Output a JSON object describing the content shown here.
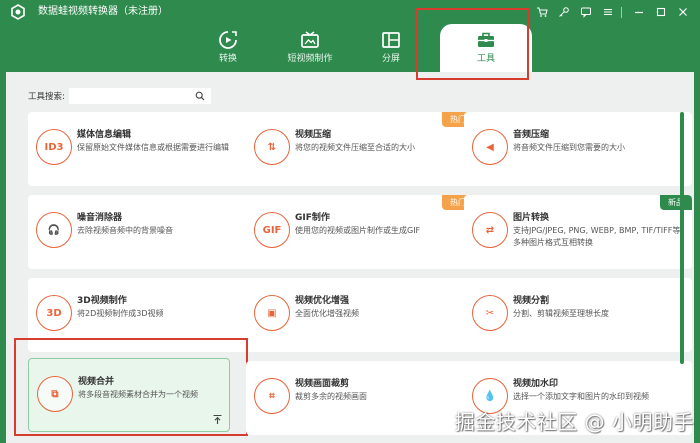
{
  "window": {
    "title": "数据蛙视频转换器（未注册）"
  },
  "nav": {
    "tabs": [
      {
        "label": "转换",
        "icon": "convert-icon",
        "active": false
      },
      {
        "label": "短视频制作",
        "icon": "short-video-icon",
        "active": false
      },
      {
        "label": "分屏",
        "icon": "split-screen-icon",
        "active": false
      },
      {
        "label": "工具",
        "icon": "toolbox-icon",
        "active": true
      }
    ]
  },
  "search": {
    "label": "工具搜索:",
    "value": "",
    "placeholder": ""
  },
  "tools": [
    {
      "title": "媒体信息编辑",
      "desc": "保留原始文件媒体信息或根据需要进行编辑",
      "icon_text": "ID3",
      "badge": ""
    },
    {
      "title": "视频压缩",
      "desc": "将您的视频文件压缩至合适的大小",
      "icon_text": "⇅",
      "badge": "热门"
    },
    {
      "title": "音频压缩",
      "desc": "将音频文件压缩到您需要的大小",
      "icon_text": "◀",
      "badge": ""
    },
    {
      "title": "噪音消除器",
      "desc": "去除视频音频中的背景噪音",
      "icon_text": "🎧",
      "badge": ""
    },
    {
      "title": "GIF制作",
      "desc": "使用您的视频或图片制作或生成GIF",
      "icon_text": "GIF",
      "badge": "热门"
    },
    {
      "title": "图片转换",
      "desc": "支持JPG/JPEG, PNG, WEBP, BMP, TIF/TIFF等多种图片格式互相转换",
      "icon_text": "⇄",
      "badge": "新品"
    },
    {
      "title": "3D视频制作",
      "desc": "将2D视频制作成3D视频",
      "icon_text": "3D",
      "badge": ""
    },
    {
      "title": "视频优化增强",
      "desc": "全面优化增强视频",
      "icon_text": "▣",
      "badge": ""
    },
    {
      "title": "视频分割",
      "desc": "分割、剪辑视频至理想长度",
      "icon_text": "✂",
      "badge": ""
    },
    {
      "title": "视频合并",
      "desc": "将多段音视频素材合并为一个视频",
      "icon_text": "⧉",
      "badge": ""
    },
    {
      "title": "视频画面裁剪",
      "desc": "裁剪多余的视频画面",
      "icon_text": "⌗",
      "badge": ""
    },
    {
      "title": "视频加水印",
      "desc": "选择一个添加文字和图片的水印到视频",
      "icon_text": "💧",
      "badge": ""
    }
  ],
  "watermark": "掘金技术社区 @ 小明助手",
  "colors": {
    "brand_green": "#2e8a4d",
    "accent_orange": "#e8643a",
    "hot_badge": "#f5a34b",
    "highlight_red": "#d73d2e"
  }
}
